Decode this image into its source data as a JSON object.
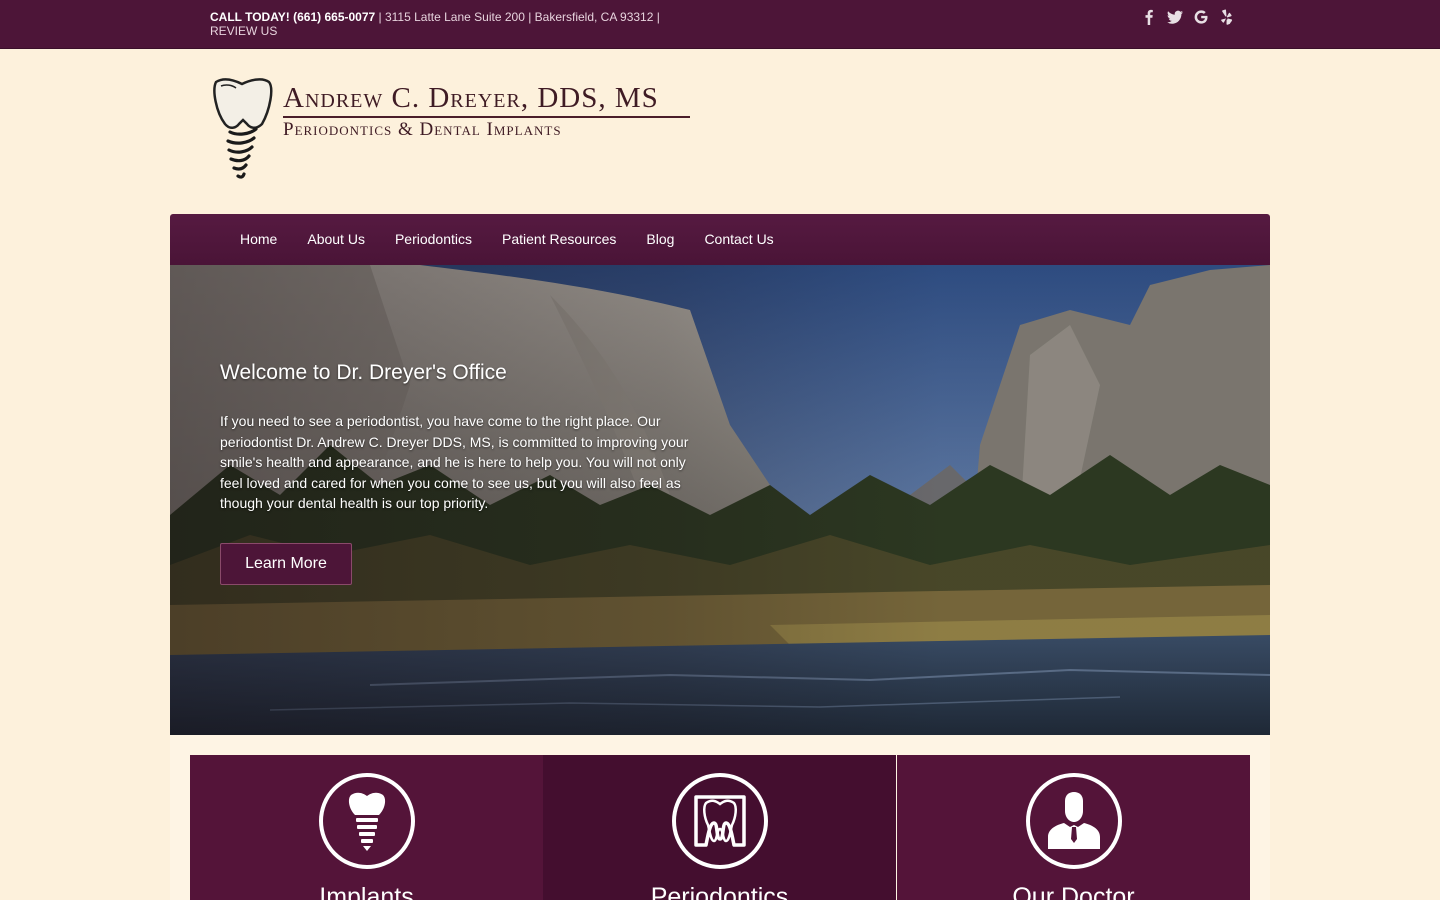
{
  "topbar": {
    "call_label": "CALL TODAY! (661) 665-0077",
    "address": " | 3115 Latte Lane Suite 200 | Bakersfield, CA 93312 | ",
    "review_link": "REVIEW US",
    "social_icons": [
      "facebook-icon",
      "twitter-icon",
      "google-icon",
      "yelp-icon"
    ]
  },
  "logo": {
    "name": "Andrew C. Dreyer, DDS, MS",
    "tagline": "Periodontics & Dental Implants"
  },
  "nav": {
    "items": [
      "Home",
      "About Us",
      "Periodontics",
      "Patient Resources",
      "Blog",
      "Contact Us"
    ]
  },
  "hero": {
    "title": "Welcome to Dr. Dreyer's Office",
    "body": "If you need to see a periodontist, you have come to the right place.  Our periodontist Dr. Andrew C. Dreyer DDS, MS, is committed to improving your smile's health and appearance, and he is here to help you. You will not only feel loved and cared for when you come to see us, but you will also feel as though your dental health is our top priority.",
    "button": "Learn More"
  },
  "features": [
    {
      "title": "Implants",
      "icon": "dental-implant-icon"
    },
    {
      "title": "Periodontics",
      "icon": "tooth-icon"
    },
    {
      "title": "Our Doctor",
      "icon": "doctor-icon"
    }
  ],
  "colors": {
    "brand": "#4d1538",
    "background": "#fdf1dc",
    "feature_panel": "#541439",
    "feature_panel_alt": "#440e2f"
  }
}
